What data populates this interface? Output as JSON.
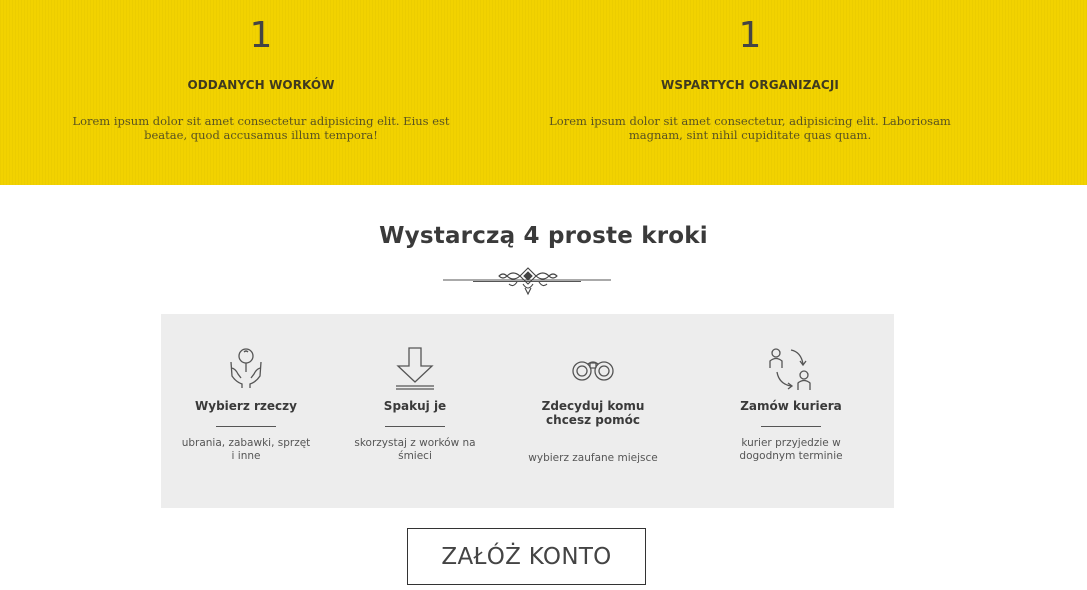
{
  "stats": [
    {
      "number": "1",
      "label": "ODDANYCH WORKÓW",
      "description": "Lorem ipsum dolor sit amet consectetur adipisicing elit. Eius est beatae, quod accusamus illum tempora!"
    },
    {
      "number": "1",
      "label": "WSPARTYCH ORGANIZACJI",
      "description": "Lorem ipsum dolor sit amet consectetur, adipisicing elit. Laboriosam magnam, sint nihil cupiditate quas quam."
    }
  ],
  "steps_section": {
    "heading": "Wystarczą 4 proste kroki",
    "steps": [
      {
        "icon": "hands-balloon-icon",
        "title": "Wybierz rzeczy",
        "description": "ubrania, zabawki, sprzęt i inne"
      },
      {
        "icon": "download-arrow-icon",
        "title": "Spakuj je",
        "description": "skorzystaj z worków na śmieci"
      },
      {
        "icon": "binoculars-icon",
        "title": "Zdecyduj komu chcesz pomóc",
        "description": "wybierz zaufane miejsce"
      },
      {
        "icon": "courier-exchange-icon",
        "title": "Zamów kuriera",
        "description": "kurier przyjedzie w dogodnym terminie"
      }
    ]
  },
  "cta": {
    "label": "ZAŁÓŻ KONTO"
  },
  "colors": {
    "accent_yellow": "#f2d200",
    "steps_background": "#ededed"
  }
}
